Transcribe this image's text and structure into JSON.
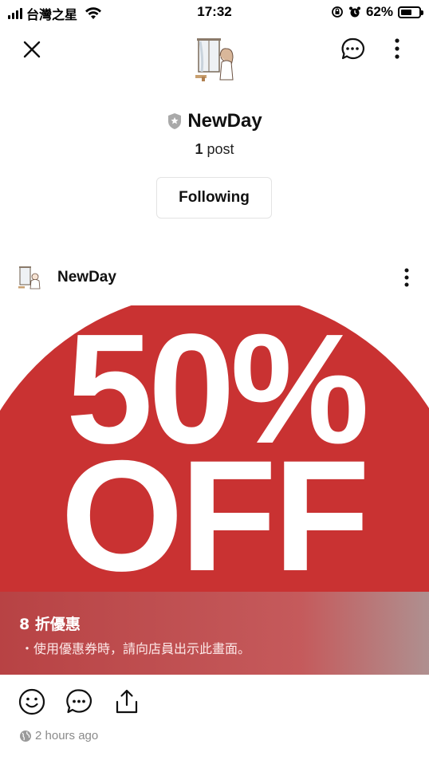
{
  "status_bar": {
    "carrier": "台灣之星",
    "time": "17:32",
    "battery_percent": "62%",
    "battery_level": 0.62
  },
  "header": {
    "icons": {
      "close": "close-icon",
      "chat": "chat-bubble-icon",
      "more": "more-vertical-icon"
    }
  },
  "profile": {
    "name": "NewDay",
    "post_count": "1",
    "post_label": " post",
    "follow_label": "Following"
  },
  "post": {
    "author": "NewDay",
    "image_text": {
      "percent": "50%",
      "off": "OFF"
    },
    "coupon": {
      "title": "8 折優惠",
      "description": "・使用優惠券時，請向店員出示此畫面。"
    },
    "timestamp": "2 hours ago"
  },
  "colors": {
    "badge_red": "#c93232",
    "text_primary": "#111111",
    "text_muted": "#8a8a8a"
  }
}
